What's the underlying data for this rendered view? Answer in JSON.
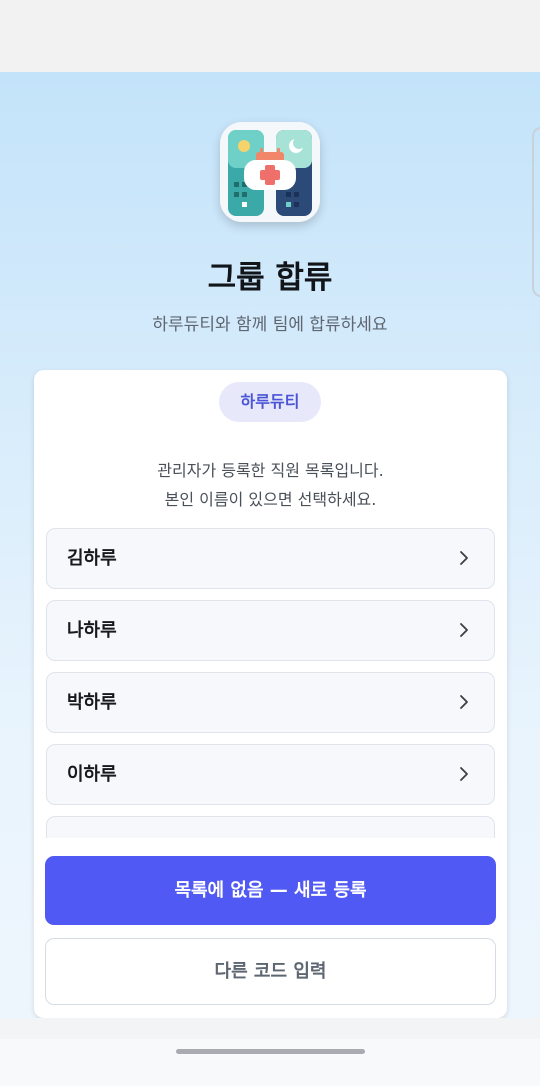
{
  "header": {
    "title": "그룹 합류",
    "subtitle": "하루듀티와 함께 팀에 합류하세요",
    "app_icon": "calendar-medical-app-icon"
  },
  "card": {
    "group_badge": "하루듀티",
    "description_line1": "관리자가 등록한 직원 목록입니다.",
    "description_line2": "본인 이름이 있으면 선택하세요.",
    "members": [
      {
        "name": "김하루"
      },
      {
        "name": "나하루"
      },
      {
        "name": "박하루"
      },
      {
        "name": "이하루"
      },
      {
        "name": ""
      }
    ],
    "primary_button": "목록에 없음 — 새로 등록",
    "secondary_button": "다른 코드 입력"
  },
  "colors": {
    "accent": "#5059f3",
    "badge_bg": "#e7e9fb",
    "badge_text": "#4b55d6",
    "background_top": "#c3e3fa",
    "background_bottom": "#eef6fd"
  }
}
